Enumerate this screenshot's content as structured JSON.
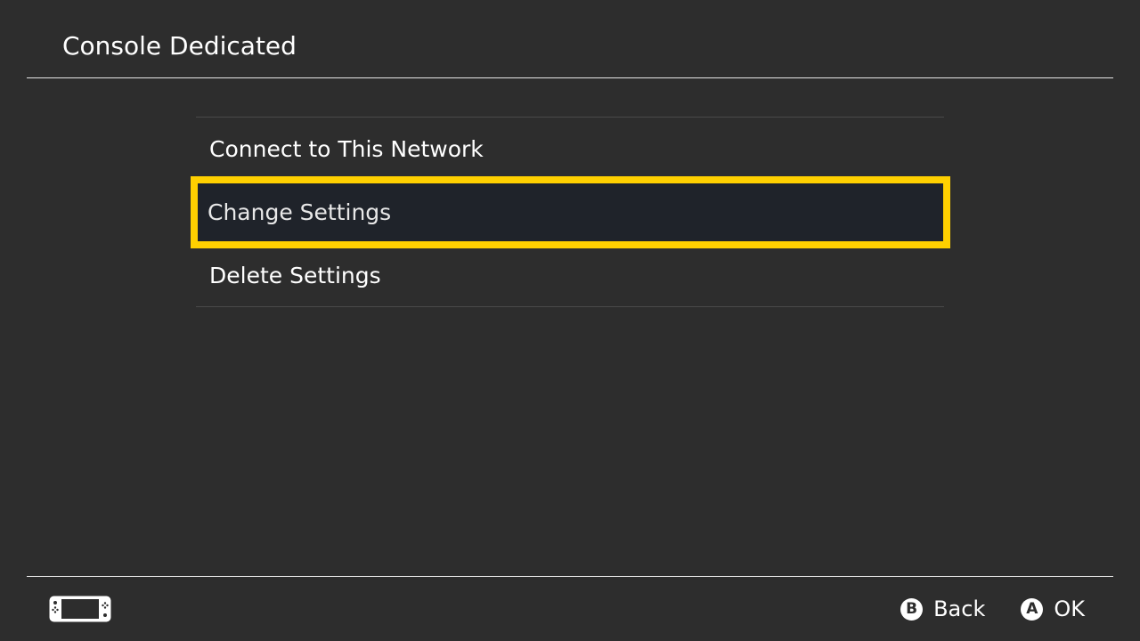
{
  "header": {
    "title": "Console Dedicated"
  },
  "menu": {
    "items": [
      {
        "label": "Connect to This Network",
        "selected": false
      },
      {
        "label": "Change Settings",
        "selected": true
      },
      {
        "label": "Delete Settings",
        "selected": false
      }
    ]
  },
  "footer": {
    "console_icon": "handheld-console-icon",
    "actions": [
      {
        "glyph": "B",
        "label": "Back",
        "icon": "b-button-icon"
      },
      {
        "glyph": "A",
        "label": "OK",
        "icon": "a-button-icon"
      }
    ]
  },
  "colors": {
    "background": "#2d2d2d",
    "highlight": "#ffd000",
    "selected_fill": "#1f232a"
  }
}
